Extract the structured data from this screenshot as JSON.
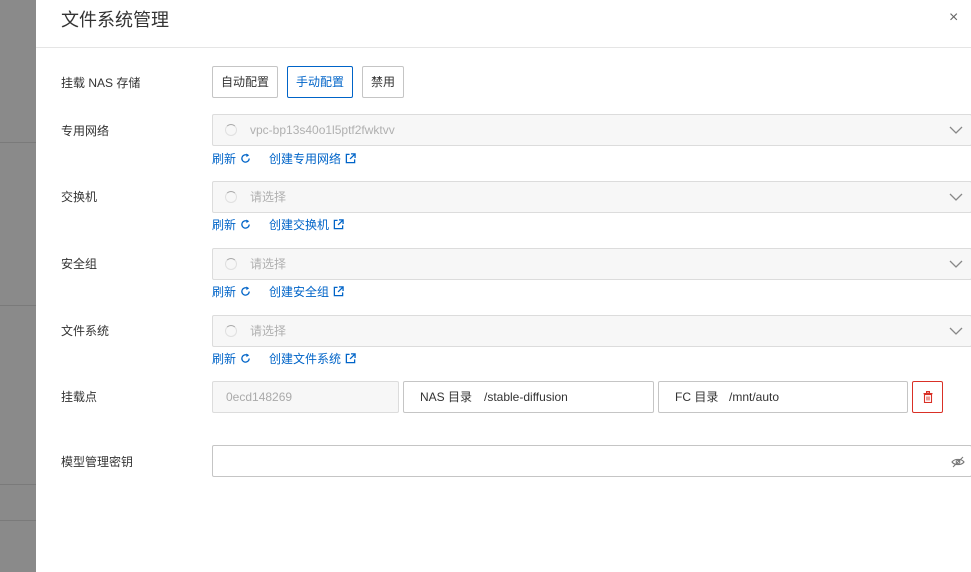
{
  "drawer": {
    "title": "文件系统管理",
    "close_label": "×"
  },
  "mount_nas": {
    "label": "挂载 NAS 存储",
    "options": [
      {
        "label": "自动配置",
        "active": false
      },
      {
        "label": "手动配置",
        "active": true
      },
      {
        "label": "禁用",
        "active": false
      }
    ]
  },
  "vpc": {
    "label": "专用网络",
    "value": "vpc-bp13s40o1l5ptf2fwktvv",
    "refresh_label": "刷新",
    "create_label": "创建专用网络"
  },
  "vswitch": {
    "label": "交换机",
    "placeholder": "请选择",
    "refresh_label": "刷新",
    "create_label": "创建交换机"
  },
  "security_group": {
    "label": "安全组",
    "placeholder": "请选择",
    "refresh_label": "刷新",
    "create_label": "创建安全组"
  },
  "file_system": {
    "label": "文件系统",
    "placeholder": "请选择",
    "refresh_label": "刷新",
    "create_label": "创建文件系统"
  },
  "mount_point": {
    "label": "挂载点",
    "id_value": "0ecd148269",
    "nas_dir_label": "NAS 目录",
    "nas_dir_value": "/stable-diffusion",
    "fc_dir_label": "FC 目录",
    "fc_dir_value": "/mnt/auto"
  },
  "model_secret": {
    "label": "模型管理密钥",
    "value": ""
  },
  "colors": {
    "primary": "#0064c8",
    "danger": "#d93026",
    "border": "#c5c5c5",
    "disabled_bg": "#f7f7f7"
  }
}
